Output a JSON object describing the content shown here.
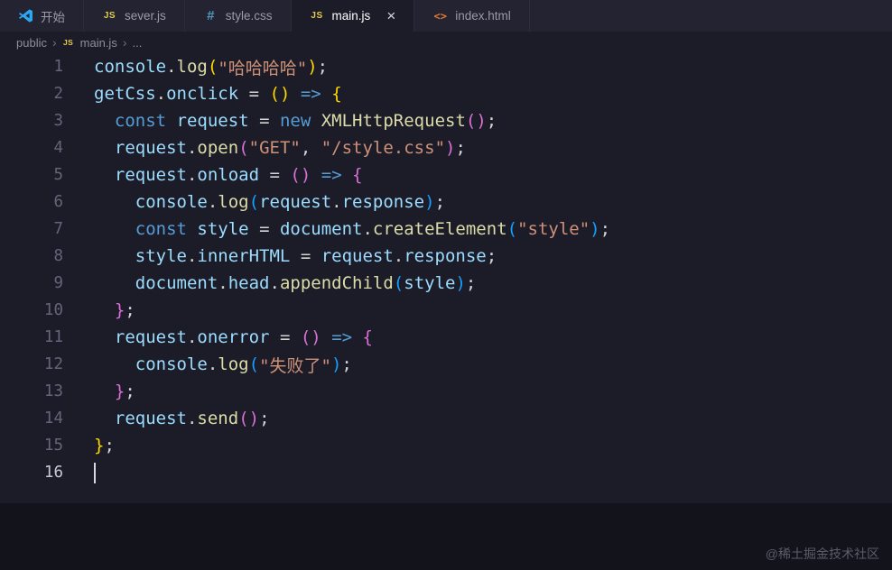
{
  "icons": {
    "js": "JS",
    "css": "#",
    "html": "<>",
    "close": "×"
  },
  "tabs": {
    "items": [
      {
        "label": "开始",
        "icon": "vscode-logo",
        "active": false
      },
      {
        "label": "sever.js",
        "icon": "js-badge",
        "active": false
      },
      {
        "label": "style.css",
        "icon": "css-hash",
        "active": false
      },
      {
        "label": "main.js",
        "icon": "js-badge",
        "active": true
      },
      {
        "label": "index.html",
        "icon": "html-tag",
        "active": false
      }
    ]
  },
  "breadcrumb": {
    "items": [
      "public",
      "main.js",
      "..."
    ],
    "separator": "›"
  },
  "editor": {
    "active_line": 16,
    "cursor_line": 16,
    "colors": {
      "fg": "#d4d4d4",
      "kw": "#569cd6",
      "var": "#9cdcfe",
      "fn": "#dcdcaa",
      "str": "#ce9178",
      "b1": "#ffd700",
      "b2": "#da70d6",
      "b3": "#179fff"
    },
    "lines": [
      {
        "n": 1,
        "t": [
          [
            "console",
            "var"
          ],
          [
            ".",
            "fg"
          ],
          [
            "log",
            "fn"
          ],
          [
            "(",
            "b1"
          ],
          [
            "\"哈哈哈哈\"",
            "str"
          ],
          [
            ")",
            "b1"
          ],
          [
            ";",
            "fg"
          ]
        ]
      },
      {
        "n": 2,
        "t": [
          [
            "getCss",
            "var"
          ],
          [
            ".",
            "fg"
          ],
          [
            "onclick",
            "var"
          ],
          [
            " = ",
            "fg"
          ],
          [
            "(",
            "b1"
          ],
          [
            ")",
            "b1"
          ],
          [
            " ",
            "fg"
          ],
          [
            "=>",
            "kw"
          ],
          [
            " ",
            "fg"
          ],
          [
            "{",
            "b1"
          ]
        ]
      },
      {
        "n": 3,
        "t": [
          [
            "  ",
            "fg"
          ],
          [
            "const",
            "kw"
          ],
          [
            " ",
            "fg"
          ],
          [
            "request",
            "var"
          ],
          [
            " = ",
            "fg"
          ],
          [
            "new",
            "kw"
          ],
          [
            " ",
            "fg"
          ],
          [
            "XMLHttpRequest",
            "fn"
          ],
          [
            "(",
            "b2"
          ],
          [
            ")",
            "b2"
          ],
          [
            ";",
            "fg"
          ]
        ]
      },
      {
        "n": 4,
        "t": [
          [
            "  ",
            "fg"
          ],
          [
            "request",
            "var"
          ],
          [
            ".",
            "fg"
          ],
          [
            "open",
            "fn"
          ],
          [
            "(",
            "b2"
          ],
          [
            "\"GET\"",
            "str"
          ],
          [
            ", ",
            "fg"
          ],
          [
            "\"/style.css\"",
            "str"
          ],
          [
            ")",
            "b2"
          ],
          [
            ";",
            "fg"
          ]
        ]
      },
      {
        "n": 5,
        "t": [
          [
            "  ",
            "fg"
          ],
          [
            "request",
            "var"
          ],
          [
            ".",
            "fg"
          ],
          [
            "onload",
            "var"
          ],
          [
            " = ",
            "fg"
          ],
          [
            "(",
            "b2"
          ],
          [
            ")",
            "b2"
          ],
          [
            " ",
            "fg"
          ],
          [
            "=>",
            "kw"
          ],
          [
            " ",
            "fg"
          ],
          [
            "{",
            "b2"
          ]
        ]
      },
      {
        "n": 6,
        "t": [
          [
            "    ",
            "fg"
          ],
          [
            "console",
            "var"
          ],
          [
            ".",
            "fg"
          ],
          [
            "log",
            "fn"
          ],
          [
            "(",
            "b3"
          ],
          [
            "request",
            "var"
          ],
          [
            ".",
            "fg"
          ],
          [
            "response",
            "var"
          ],
          [
            ")",
            "b3"
          ],
          [
            ";",
            "fg"
          ]
        ]
      },
      {
        "n": 7,
        "t": [
          [
            "    ",
            "fg"
          ],
          [
            "const",
            "kw"
          ],
          [
            " ",
            "fg"
          ],
          [
            "style",
            "var"
          ],
          [
            " = ",
            "fg"
          ],
          [
            "document",
            "var"
          ],
          [
            ".",
            "fg"
          ],
          [
            "createElement",
            "fn"
          ],
          [
            "(",
            "b3"
          ],
          [
            "\"style\"",
            "str"
          ],
          [
            ")",
            "b3"
          ],
          [
            ";",
            "fg"
          ]
        ]
      },
      {
        "n": 8,
        "t": [
          [
            "    ",
            "fg"
          ],
          [
            "style",
            "var"
          ],
          [
            ".",
            "fg"
          ],
          [
            "innerHTML",
            "var"
          ],
          [
            " = ",
            "fg"
          ],
          [
            "request",
            "var"
          ],
          [
            ".",
            "fg"
          ],
          [
            "response",
            "var"
          ],
          [
            ";",
            "fg"
          ]
        ]
      },
      {
        "n": 9,
        "t": [
          [
            "    ",
            "fg"
          ],
          [
            "document",
            "var"
          ],
          [
            ".",
            "fg"
          ],
          [
            "head",
            "var"
          ],
          [
            ".",
            "fg"
          ],
          [
            "appendChild",
            "fn"
          ],
          [
            "(",
            "b3"
          ],
          [
            "style",
            "var"
          ],
          [
            ")",
            "b3"
          ],
          [
            ";",
            "fg"
          ]
        ]
      },
      {
        "n": 10,
        "t": [
          [
            "  ",
            "fg"
          ],
          [
            "}",
            "b2"
          ],
          [
            ";",
            "fg"
          ]
        ]
      },
      {
        "n": 11,
        "t": [
          [
            "  ",
            "fg"
          ],
          [
            "request",
            "var"
          ],
          [
            ".",
            "fg"
          ],
          [
            "onerror",
            "var"
          ],
          [
            " = ",
            "fg"
          ],
          [
            "(",
            "b2"
          ],
          [
            ")",
            "b2"
          ],
          [
            " ",
            "fg"
          ],
          [
            "=>",
            "kw"
          ],
          [
            " ",
            "fg"
          ],
          [
            "{",
            "b2"
          ]
        ]
      },
      {
        "n": 12,
        "t": [
          [
            "    ",
            "fg"
          ],
          [
            "console",
            "var"
          ],
          [
            ".",
            "fg"
          ],
          [
            "log",
            "fn"
          ],
          [
            "(",
            "b3"
          ],
          [
            "\"失败了\"",
            "str"
          ],
          [
            ")",
            "b3"
          ],
          [
            ";",
            "fg"
          ]
        ]
      },
      {
        "n": 13,
        "t": [
          [
            "  ",
            "fg"
          ],
          [
            "}",
            "b2"
          ],
          [
            ";",
            "fg"
          ]
        ]
      },
      {
        "n": 14,
        "t": [
          [
            "  ",
            "fg"
          ],
          [
            "request",
            "var"
          ],
          [
            ".",
            "fg"
          ],
          [
            "send",
            "fn"
          ],
          [
            "(",
            "b2"
          ],
          [
            ")",
            "b2"
          ],
          [
            ";",
            "fg"
          ]
        ]
      },
      {
        "n": 15,
        "t": [
          [
            "}",
            "b1"
          ],
          [
            ";",
            "fg"
          ]
        ]
      },
      {
        "n": 16,
        "t": []
      }
    ]
  },
  "watermark": {
    "text": "@稀土掘金技术社区"
  },
  "theme": {
    "editor_bg": "#1c1c28",
    "tabbar_bg": "#232331",
    "footer_bg": "#13131c",
    "js_icon_color": "#e3cd4b",
    "css_icon_color": "#519aba",
    "html_icon_color": "#e37933"
  }
}
